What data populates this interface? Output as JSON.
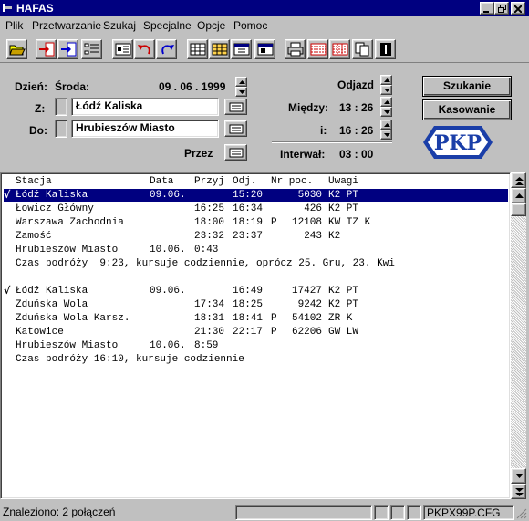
{
  "window": {
    "title": "HAFAS"
  },
  "menu": [
    "Plik",
    "Przetwarzanie",
    "Szukaj",
    "Specjalne",
    "Opcje",
    "Pomoc"
  ],
  "form": {
    "day_label": "Dzień:",
    "day_value": "Środa:",
    "date": "09 . 06 . 1999",
    "from_label": "Z:",
    "from_value": "Łódź Kaliska",
    "to_label": "Do:",
    "to_value": "Hrubieszów Miasto",
    "via_label": "Przez",
    "departure_label": "Odjazd",
    "between_label": "Między:",
    "time_from": "13 : 26",
    "and_label": "i:",
    "time_to": "16 : 26",
    "interval_label": "Interwał:",
    "interval_value": "03 : 00"
  },
  "buttons": {
    "search": "Szukanie",
    "delete": "Kasowanie"
  },
  "logo": "PKP",
  "table": {
    "headers": [
      "Stacja",
      "Data",
      "Przyj",
      "Odj.",
      "Nr poc.",
      "Uwagi"
    ],
    "rows": [
      {
        "check": "√",
        "station": "Łódź Kaliska",
        "date": "09.06.",
        "arr": "",
        "dep": "15:20",
        "flag": "",
        "train": "5030",
        "notes": "K2 PT",
        "selected": true
      },
      {
        "station": "Łowicz Główny",
        "date": "",
        "arr": "16:25",
        "dep": "16:34",
        "flag": "",
        "train": "426",
        "notes": "K2 PT"
      },
      {
        "station": "Warszawa Zachodnia",
        "date": "",
        "arr": "18:00",
        "dep": "18:19",
        "flag": "P",
        "train": "12108",
        "notes": "KW TZ K"
      },
      {
        "station": "Zamość",
        "date": "",
        "arr": "23:32",
        "dep": "23:37",
        "flag": "",
        "train": "243",
        "notes": "K2"
      },
      {
        "station": "Hrubieszów Miasto",
        "date": "10.06.",
        "arr": "0:43",
        "dep": "",
        "flag": "",
        "train": "",
        "notes": ""
      },
      {
        "summary": "Czas podróży  9:23, kursuje codziennie, oprócz 25. Gru, 23. Kwi"
      },
      {
        "blank": true
      },
      {
        "check": "√",
        "station": "Łódź Kaliska",
        "date": "09.06.",
        "arr": "",
        "dep": "16:49",
        "flag": "",
        "train": "17427",
        "notes": "K2 PT"
      },
      {
        "station": "Zduńska Wola",
        "date": "",
        "arr": "17:34",
        "dep": "18:25",
        "flag": "",
        "train": "9242",
        "notes": "K2 PT"
      },
      {
        "station": "Zduńska Wola Karsz.",
        "date": "",
        "arr": "18:31",
        "dep": "18:41",
        "flag": "P",
        "train": "54102",
        "notes": "ZR K"
      },
      {
        "station": "Katowice",
        "date": "",
        "arr": "21:30",
        "dep": "22:17",
        "flag": "P",
        "train": "62206",
        "notes": "GW LW"
      },
      {
        "station": "Hrubieszów Miasto",
        "date": "10.06.",
        "arr": "8:59",
        "dep": "",
        "flag": "",
        "train": "",
        "notes": ""
      },
      {
        "summary": "Czas podróży 16:10, kursuje codziennie"
      }
    ]
  },
  "status": {
    "found": "Znaleziono: 2 połączeń",
    "config": "PKPX99P.CFG"
  },
  "colors": {
    "titlebar": "#000080",
    "selection": "#000080",
    "face": "#c0c0c0"
  }
}
